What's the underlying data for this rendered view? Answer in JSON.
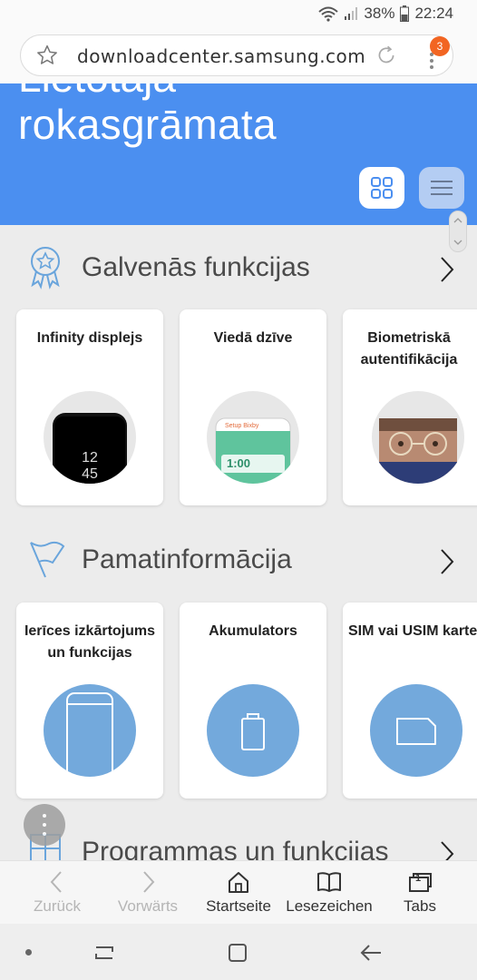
{
  "status": {
    "battery_percent": "38%",
    "time": "22:24"
  },
  "browser": {
    "url": "downloadcenter.samsung.com",
    "tab_badge": "3"
  },
  "hero": {
    "prev_title": "Lietotāja",
    "title": "rokasgrāmata"
  },
  "sections": {
    "main_features": {
      "title": "Galvenās funkcijas",
      "cards": [
        {
          "title": "Infinity displejs",
          "image_text": "12\n45"
        },
        {
          "title": "Viedā dzīve",
          "image_text": "1:00"
        },
        {
          "title": "Biometriskā autentifikācija"
        }
      ]
    },
    "basics": {
      "title": "Pamatinformācija",
      "cards": [
        {
          "title": "Ierīces izkārtojums un funkcijas"
        },
        {
          "title": "Akumulators"
        },
        {
          "title": "SIM vai USIM karte (nano SIM karte)"
        }
      ]
    },
    "apps": {
      "title": "Programmas un funkcijas"
    }
  },
  "toolbar": {
    "back": "Zurück",
    "forward": "Vorwärts",
    "home": "Startseite",
    "bookmarks": "Lesezeichen",
    "tabs": "Tabs",
    "tabs_count": "1"
  },
  "colors": {
    "hero_blue": "#4b8ff0",
    "circle_blue": "#73a9dc",
    "badge_orange": "#f26522"
  }
}
